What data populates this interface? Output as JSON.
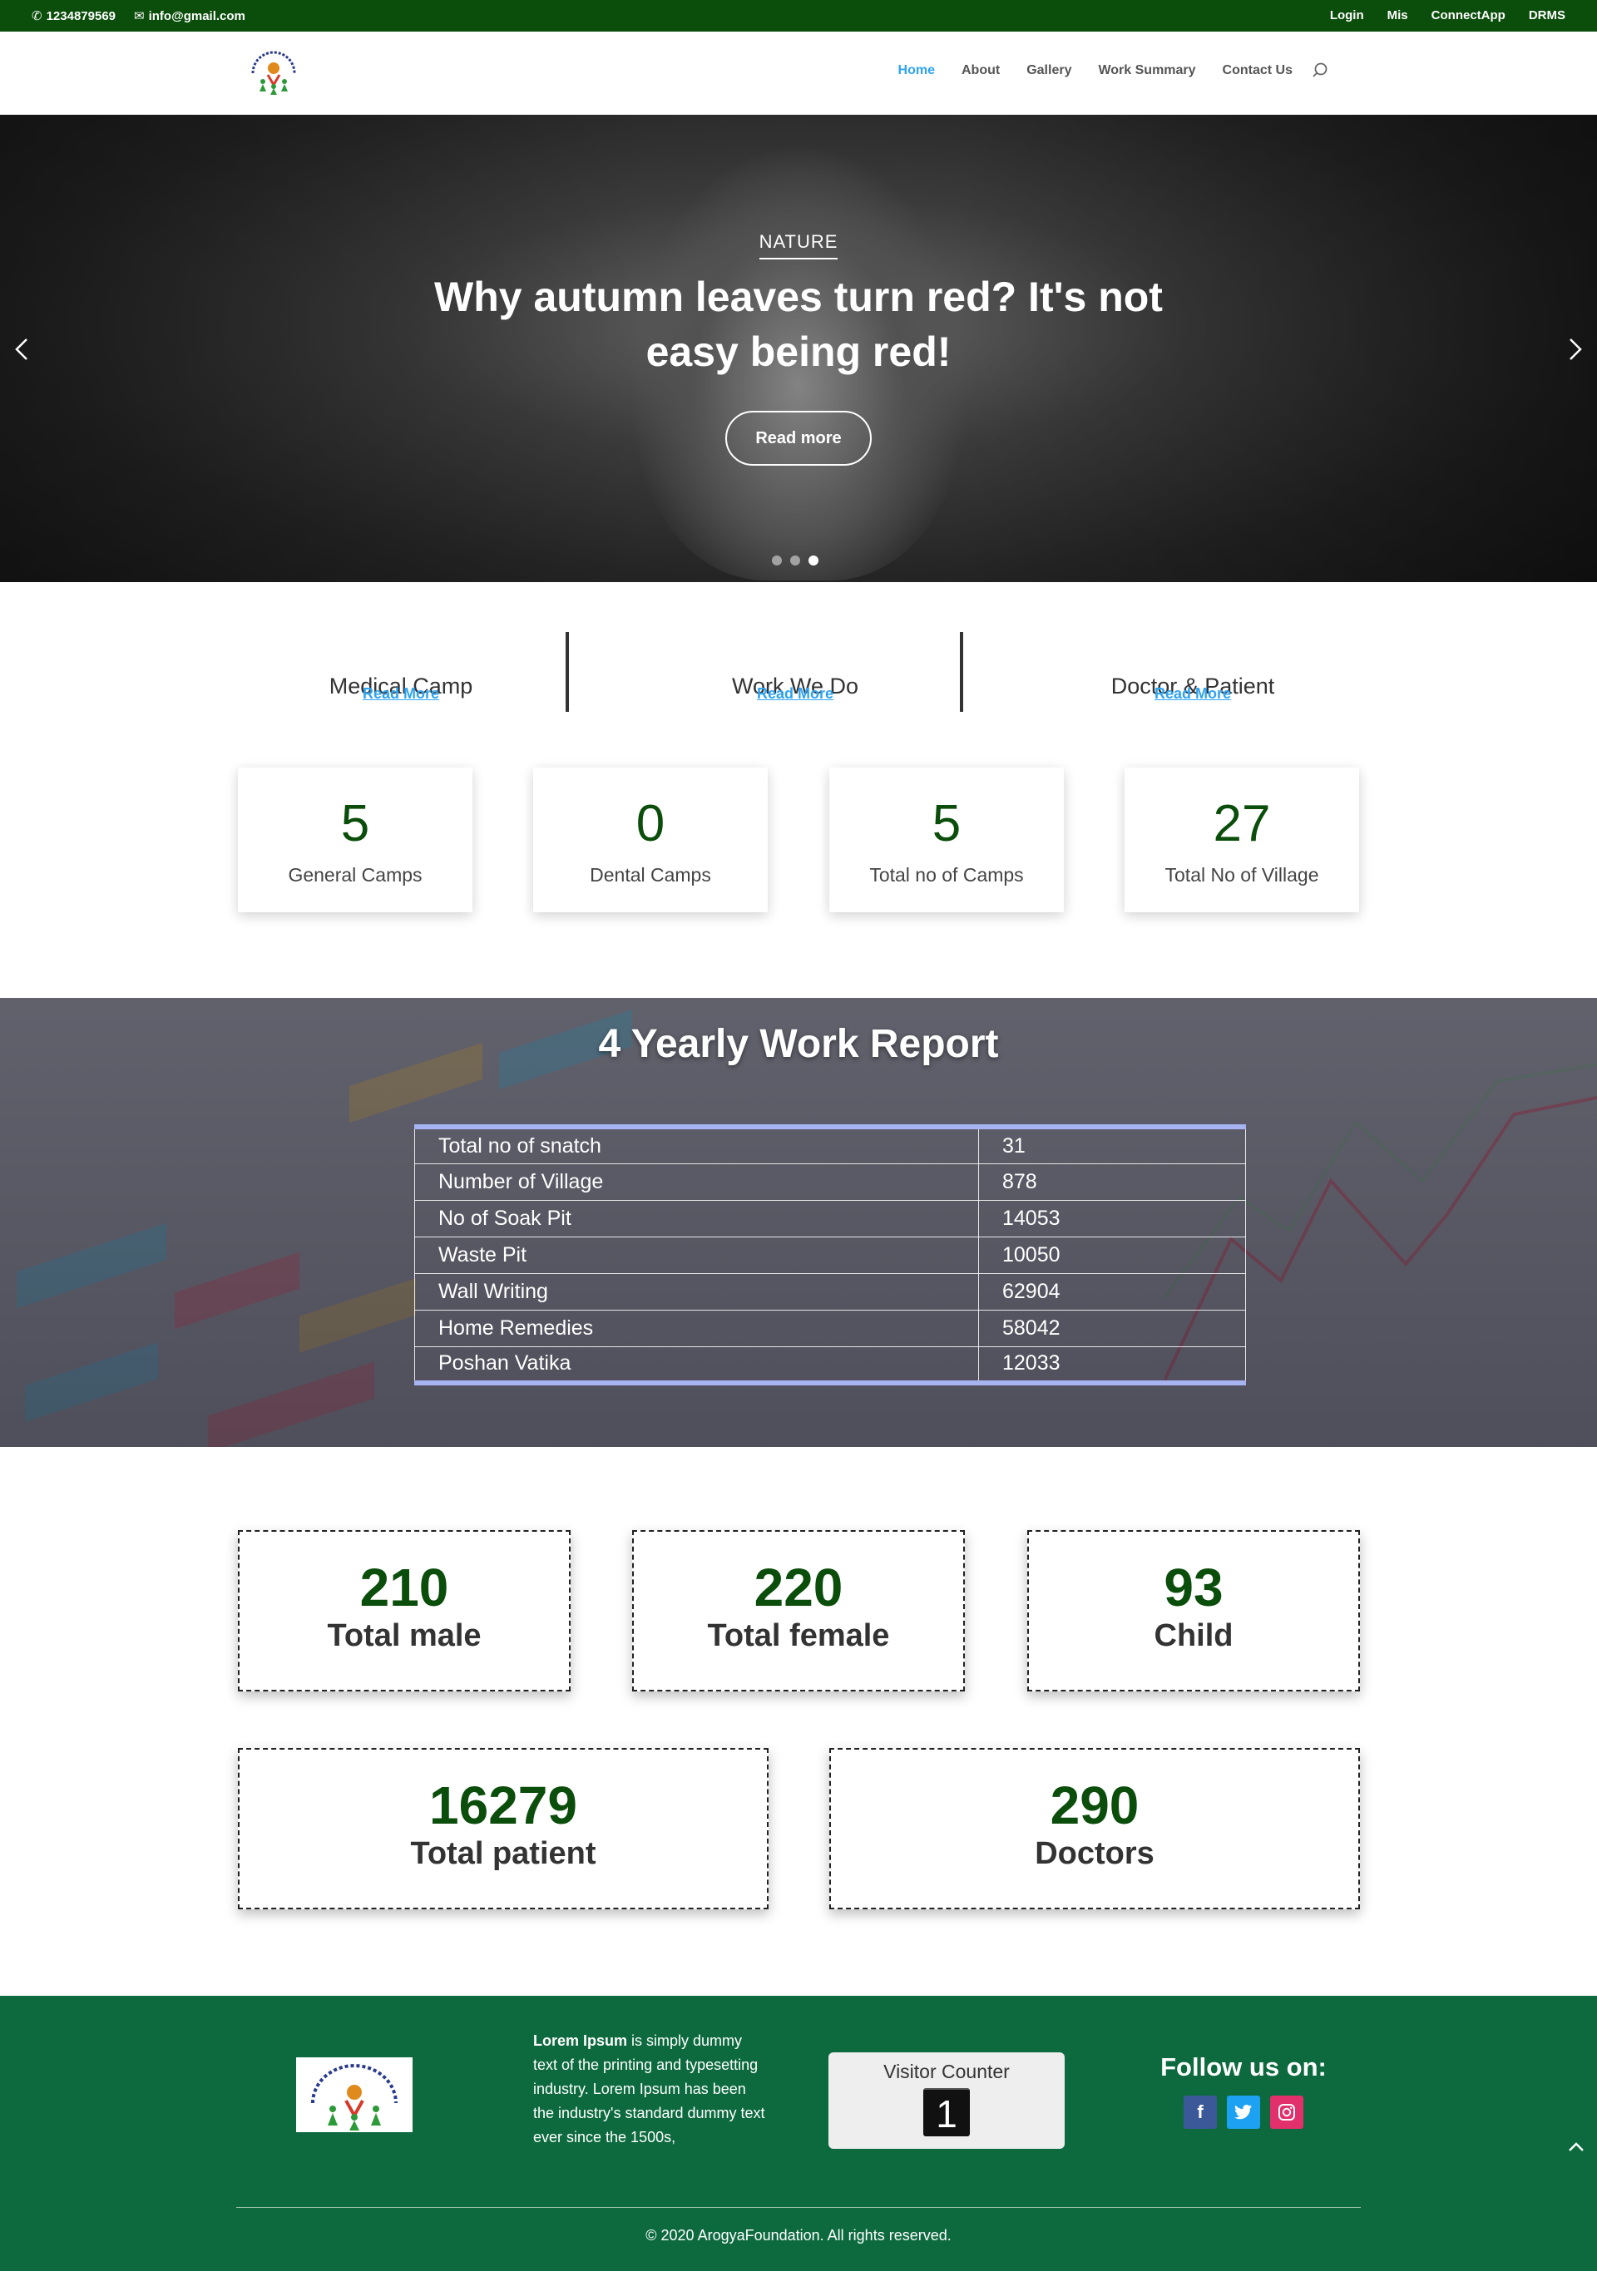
{
  "topbar": {
    "phone": "1234879569",
    "email": "info@gmail.com",
    "links": [
      "Login",
      "Mis",
      "ConnectApp",
      "DRMS"
    ]
  },
  "nav": {
    "items": [
      "Home",
      "About",
      "Gallery",
      "Work Summary",
      "Contact Us"
    ],
    "active": "Home"
  },
  "hero": {
    "category": "NATURE",
    "title": "Why autumn leaves turn red? It's not easy being red!",
    "button": "Read more",
    "slides": 3,
    "active_slide": 3
  },
  "features": [
    {
      "title": "Medical Camp",
      "link": "Read More"
    },
    {
      "title": "Work We Do",
      "link": "Read More"
    },
    {
      "title": "Doctor & Patient",
      "link": "Read More"
    }
  ],
  "stats": [
    {
      "value": "5",
      "label": "General Camps"
    },
    {
      "value": "0",
      "label": "Dental Camps"
    },
    {
      "value": "5",
      "label": "Total no of Camps"
    },
    {
      "value": "27",
      "label": "Total No of Village"
    }
  ],
  "report": {
    "title": "4 Yearly Work Report",
    "rows": [
      {
        "label": "Total no of snatch",
        "value": "31"
      },
      {
        "label": "Number of Village",
        "value": "878"
      },
      {
        "label": "No of Soak Pit",
        "value": "14053"
      },
      {
        "label": "Waste Pit",
        "value": "10050"
      },
      {
        "label": "Wall Writing",
        "value": "62904"
      },
      {
        "label": "Home Remedies",
        "value": "58042"
      },
      {
        "label": "Poshan Vatika",
        "value": "12033"
      }
    ]
  },
  "demographics": [
    {
      "value": "210",
      "label": "Total male"
    },
    {
      "value": "220",
      "label": "Total female"
    },
    {
      "value": "93",
      "label": "Child"
    },
    {
      "value": "16279",
      "label": "Total patient"
    },
    {
      "value": "290",
      "label": "Doctors"
    }
  ],
  "footer": {
    "about_bold": "Lorem Ipsum",
    "about_rest": " is simply dummy text of the printing and typesetting industry. Lorem Ipsum has been the industry's standard dummy text ever since the 1500s,",
    "counter_title": "Visitor Counter",
    "counter_value": "1",
    "follow_title": "Follow us on:",
    "copyright": "© 2020 ArogyaFoundation. All rights reserved."
  },
  "colors": {
    "topbar": "#0b4d0b",
    "accent": "#2ea3f2",
    "stat_number": "#0b4d0b",
    "footer": "#0d6a3f"
  }
}
